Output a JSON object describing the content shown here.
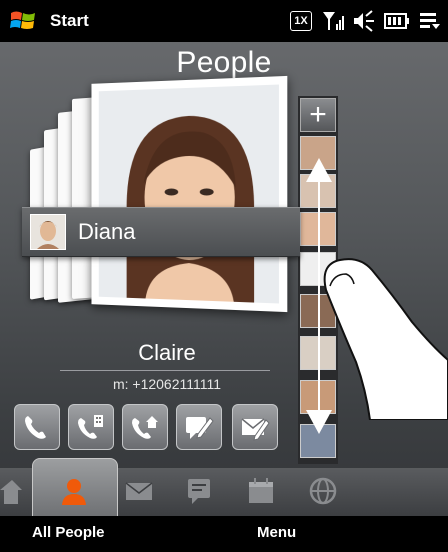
{
  "status_bar": {
    "start_label": "Start",
    "network_badge": "1X",
    "icons": [
      "windows-flag-icon",
      "signal-icon",
      "volume-icon",
      "battery-icon",
      "menu-icon"
    ]
  },
  "screen_title": "People",
  "slider": {
    "name": "Diana",
    "add_symbol": "+"
  },
  "contact": {
    "name": "Claire",
    "phone": "m: +12062111111"
  },
  "actions": [
    "phone-icon",
    "office-phone-icon",
    "home-phone-icon",
    "sms-icon",
    "email-icon"
  ],
  "tabs": [
    "home-icon",
    "people-icon",
    "mail-icon",
    "messages-icon",
    "calendar-icon",
    "internet-icon"
  ],
  "softkeys": {
    "left": "All People",
    "right": "Menu"
  },
  "colors": {
    "accent_orange": "#f05a0a",
    "background": "#4a4c4f"
  }
}
